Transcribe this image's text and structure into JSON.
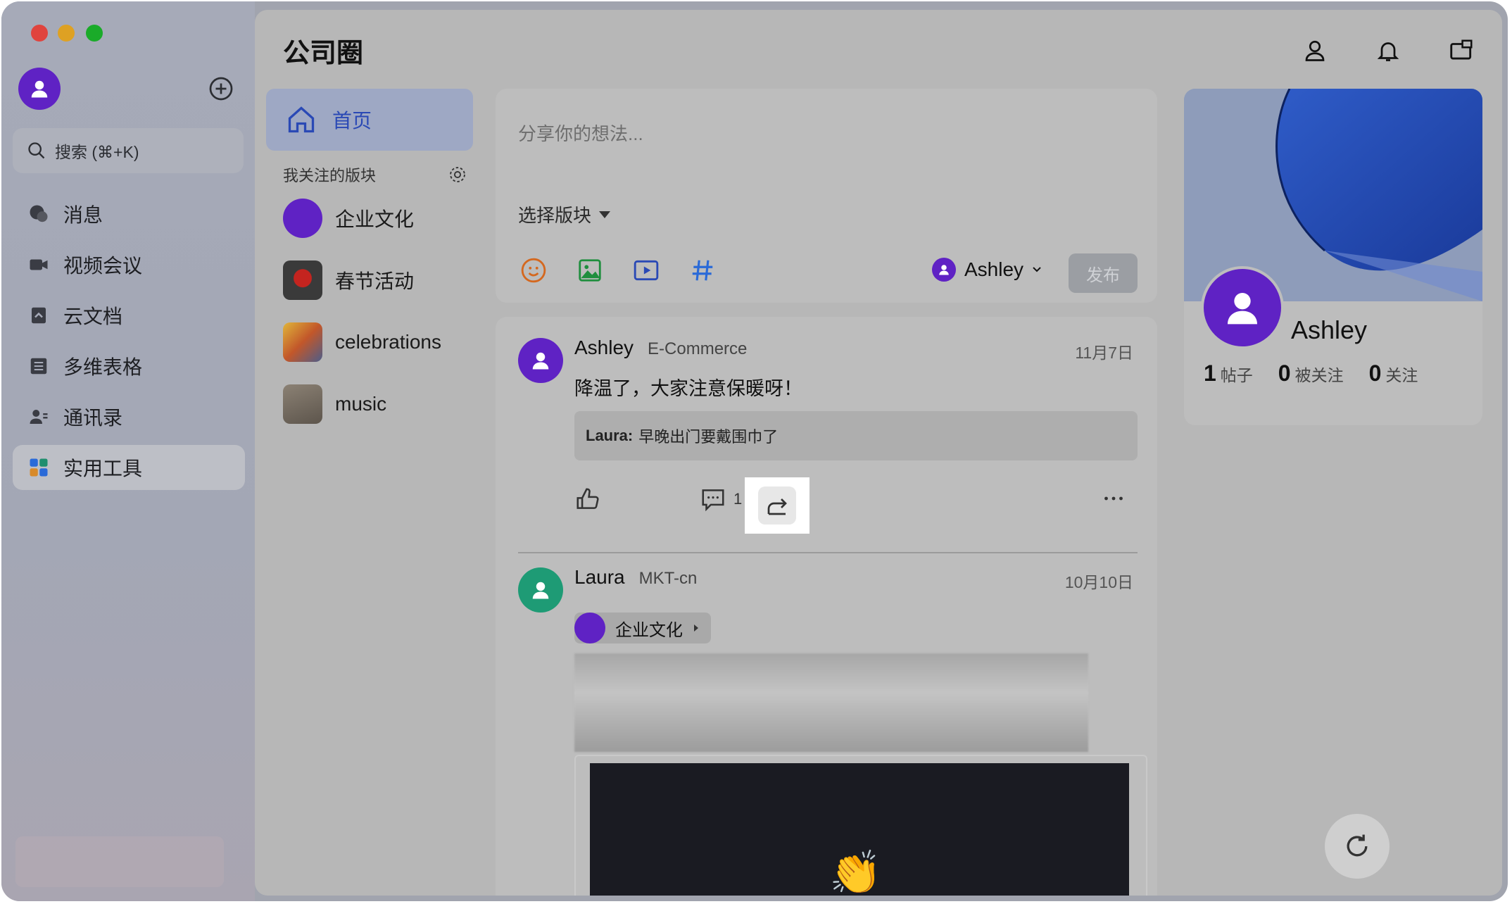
{
  "window": {
    "close_color": "#e0443e",
    "min_color": "#dea123",
    "max_color": "#1aab29"
  },
  "sidebar": {
    "search_placeholder": "搜索 (⌘+K)",
    "items": [
      {
        "label": "消息",
        "icon": "chat-icon"
      },
      {
        "label": "视频会议",
        "icon": "video-camera-icon"
      },
      {
        "label": "云文档",
        "icon": "document-icon"
      },
      {
        "label": "多维表格",
        "icon": "table-icon"
      },
      {
        "label": "通讯录",
        "icon": "contacts-icon"
      },
      {
        "label": "实用工具",
        "icon": "apps-icon",
        "active": true
      }
    ]
  },
  "header": {
    "title": "公司圈"
  },
  "boards": {
    "home_label": "首页",
    "section_title": "我关注的版块",
    "items": [
      {
        "label": "企业文化"
      },
      {
        "label": "春节活动"
      },
      {
        "label": "celebrations"
      },
      {
        "label": "music"
      }
    ]
  },
  "compose": {
    "placeholder": "分享你的想法...",
    "select_label": "选择版块",
    "author": "Ashley",
    "publish_label": "发布"
  },
  "posts": [
    {
      "name": "Ashley",
      "dept": "E-Commerce",
      "date": "11月7日",
      "text": "降温了，大家注意保暖呀！",
      "quote_author": "Laura:",
      "quote_text": "早晚出门要戴围巾了",
      "comment_count": "1"
    },
    {
      "name": "Laura",
      "dept": "MKT-cn",
      "date": "10月10日",
      "tag": "企业文化"
    }
  ],
  "profile": {
    "name": "Ashley",
    "posts_count": "1",
    "posts_label": "帖子",
    "followers_count": "0",
    "followers_label": "被关注",
    "following_count": "0",
    "following_label": "关注"
  },
  "colors": {
    "accent": "#2a49b5",
    "avatar_purple": "#5f22c4",
    "avatar_green": "#1e9b75"
  }
}
